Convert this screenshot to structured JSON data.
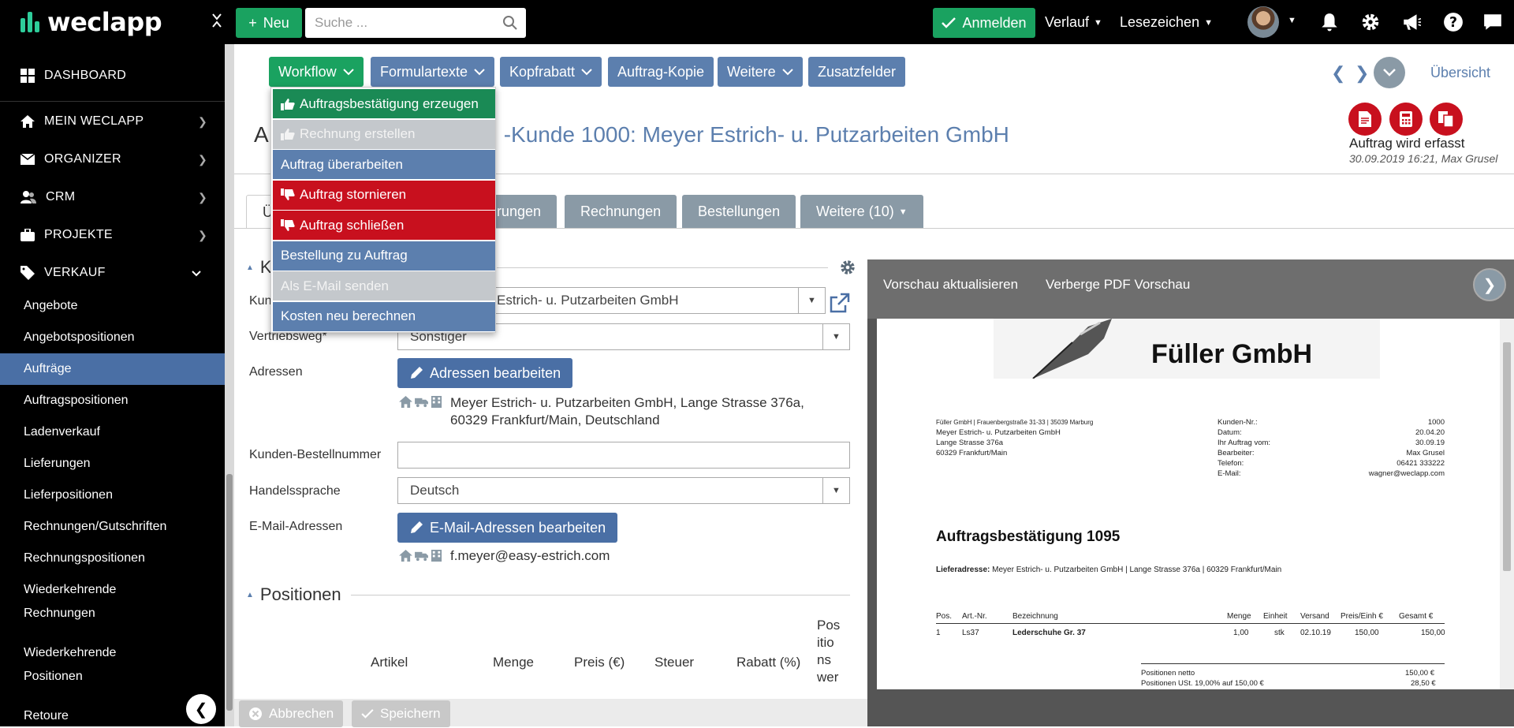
{
  "app": {
    "brand": "weclapp"
  },
  "topbar": {
    "new_label": "Neu",
    "search_placeholder": "Suche ...",
    "login_label": "Anmelden",
    "history_label": "Verlauf",
    "bookmarks_label": "Lesezeichen"
  },
  "sidebar": {
    "dashboard": "DASHBOARD",
    "main_items": [
      "MEIN WECLAPP",
      "ORGANIZER",
      "CRM",
      "PROJEKTE"
    ],
    "sales": "VERKAUF",
    "sub_items": [
      "Angebote",
      "Angebotspositionen",
      "Aufträge",
      "Auftragspositionen",
      "Ladenverkauf",
      "Lieferungen",
      "Lieferpositionen",
      "Rechnungen/Gutschriften",
      "Rechnungspositionen"
    ],
    "sub_recurring_invoices": [
      "Wiederkehrende",
      "Rechnungen"
    ],
    "sub_recurring_positions": [
      "Wiederkehrende",
      "Positionen"
    ],
    "sub_returns": "Retoure",
    "active_item": "Aufträge"
  },
  "toolbar": {
    "workflow": "Workflow",
    "formulartexte": "Formulartexte",
    "kopfrabatt": "Kopfrabatt",
    "auftrag_kopie": "Auftrag-Kopie",
    "weitere": "Weitere",
    "zusatzfelder": "Zusatzfelder",
    "overview": "Übersicht"
  },
  "workflow_menu": [
    {
      "label": "Auftragsbestätigung erzeugen",
      "style": "green",
      "icon": "thumbs-up-icon"
    },
    {
      "label": "Rechnung erstellen",
      "style": "grey",
      "icon": "thumbs-up-icon"
    },
    {
      "label": "Auftrag überarbeiten",
      "style": "blue",
      "icon": ""
    },
    {
      "label": "Auftrag stornieren",
      "style": "red",
      "icon": "thumbs-down-icon"
    },
    {
      "label": "Auftrag schließen",
      "style": "red",
      "icon": "thumbs-down-icon"
    },
    {
      "label": "Bestellung zu Auftrag",
      "style": "blue",
      "icon": ""
    },
    {
      "label": "Als E-Mail senden",
      "style": "grey",
      "icon": ""
    },
    {
      "label": "Kosten neu berechnen",
      "style": "blue",
      "icon": ""
    }
  ],
  "header": {
    "title_prefix": "A",
    "title_rest": "-Kunde 1000: Meyer Estrich- u. Putzarbeiten GmbH",
    "status": "Auftrag wird erfasst",
    "status_meta": "30.09.2019 16:21, Max Grusel"
  },
  "tabs": [
    "Ü",
    "rungen",
    "Rechnungen",
    "Bestellungen",
    "Weitere (10)"
  ],
  "form": {
    "section_initial": "K",
    "kunde_label": "Kun",
    "kunde_value": "Estrich- u. Putzarbeiten GmbH",
    "vertriebsweg_label": "Vertriebsweg*",
    "vertriebsweg_value": "Sonstiger",
    "adressen_label": "Adressen",
    "adressen_btn": "Adressen bearbeiten",
    "address_line1": "Meyer Estrich- u. Putzarbeiten GmbH, Lange Strasse 376a,",
    "address_line2": "60329 Frankfurt/Main, Deutschland",
    "bestellnr_label": "Kunden-Bestellnummer",
    "bestellnr_value": "",
    "sprache_label": "Handelssprache",
    "sprache_value": "Deutsch",
    "email_label": "E-Mail-Adressen",
    "email_btn": "E-Mail-Adressen bearbeiten",
    "email_value": "f.meyer@easy-estrich.com"
  },
  "positions": {
    "title": "Positionen",
    "columns": [
      "Artikel",
      "Menge",
      "Preis (€)",
      "Steuer",
      "Rabatt (%)"
    ],
    "last_column_lines": [
      "Pos",
      "itio",
      "ns",
      "wer"
    ]
  },
  "footer": {
    "cancel": "Abbrechen",
    "save": "Speichern"
  },
  "preview": {
    "refresh": "Vorschau aktualisieren",
    "hide": "Verberge PDF Vorschau",
    "pdf": {
      "brand": "Füller GmbH",
      "sender_line": "Füller GmbH | Frauenbergstraße 31-33 | 35039 Marburg",
      "recipient": [
        "Meyer Estrich- u. Putzarbeiten GmbH",
        "Lange Strasse 376a",
        "60329 Frankfurt/Main"
      ],
      "meta_labels": [
        "Kunden-Nr.:",
        "Datum:",
        "Ihr Auftrag vom:",
        "Bearbeiter:",
        "Telefon:",
        "E-Mail:"
      ],
      "meta_values": [
        "1000",
        "20.04.20",
        "30.09.19",
        "Max Grusel",
        "06421 333222",
        "wagner@weclapp.com"
      ],
      "heading": "Auftragsbestätigung 1095",
      "delivery_label": "Lieferadresse:",
      "delivery_value": "Meyer Estrich- u. Putzarbeiten GmbH | Lange Strasse 376a | 60329 Frankfurt/Main",
      "table_headers": [
        "Pos.",
        "Art.-Nr.",
        "Bezeichnung",
        "Menge",
        "Einheit",
        "Versand",
        "Preis/Einh €",
        "Gesamt €"
      ],
      "table_row": [
        "1",
        "Ls37",
        "Lederschuhe Gr. 37",
        "1,00",
        "stk",
        "02.10.19",
        "150,00",
        "150,00"
      ],
      "totals": [
        [
          "Positionen netto",
          "150,00 €"
        ],
        [
          "Positionen USt. 19,00% auf 150,00 €",
          "28,50 €"
        ]
      ]
    }
  },
  "colors": {
    "green": "#1aa260",
    "blue": "#5c7fae",
    "red": "#c8101e",
    "grey": "#8a9aa6"
  }
}
